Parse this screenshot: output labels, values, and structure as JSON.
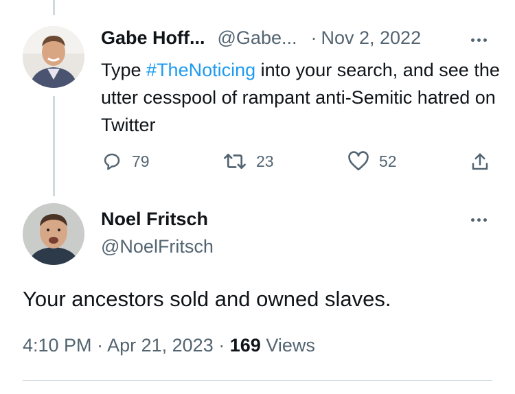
{
  "tweet1": {
    "display_name": "Gabe Hoff...",
    "handle": "@Gabe...",
    "separator": "·",
    "date": "Nov 2, 2022",
    "text_before": "Type ",
    "hashtag": "#TheNoticing",
    "text_after": " into your search, and see the utter cesspool of rampant anti-Semitic hatred on Twitter",
    "replies": "79",
    "retweets": "23",
    "likes": "52"
  },
  "tweet2": {
    "display_name": "Noel Fritsch",
    "handle": "@NoelFritsch",
    "text": "Your ancestors sold and owned slaves.",
    "time": "4:10 PM",
    "sep1": "·",
    "date": "Apr 21, 2023",
    "sep2": "·",
    "views_count": "169",
    "views_label": "Views"
  },
  "icons": {
    "reply": "reply-icon",
    "retweet": "retweet-icon",
    "like": "heart-icon",
    "share": "share-icon",
    "more": "more-icon"
  },
  "colors": {
    "text": "#0f1419",
    "secondary": "#536471",
    "link": "#1d9bf0",
    "divider": "#cfd9de"
  }
}
